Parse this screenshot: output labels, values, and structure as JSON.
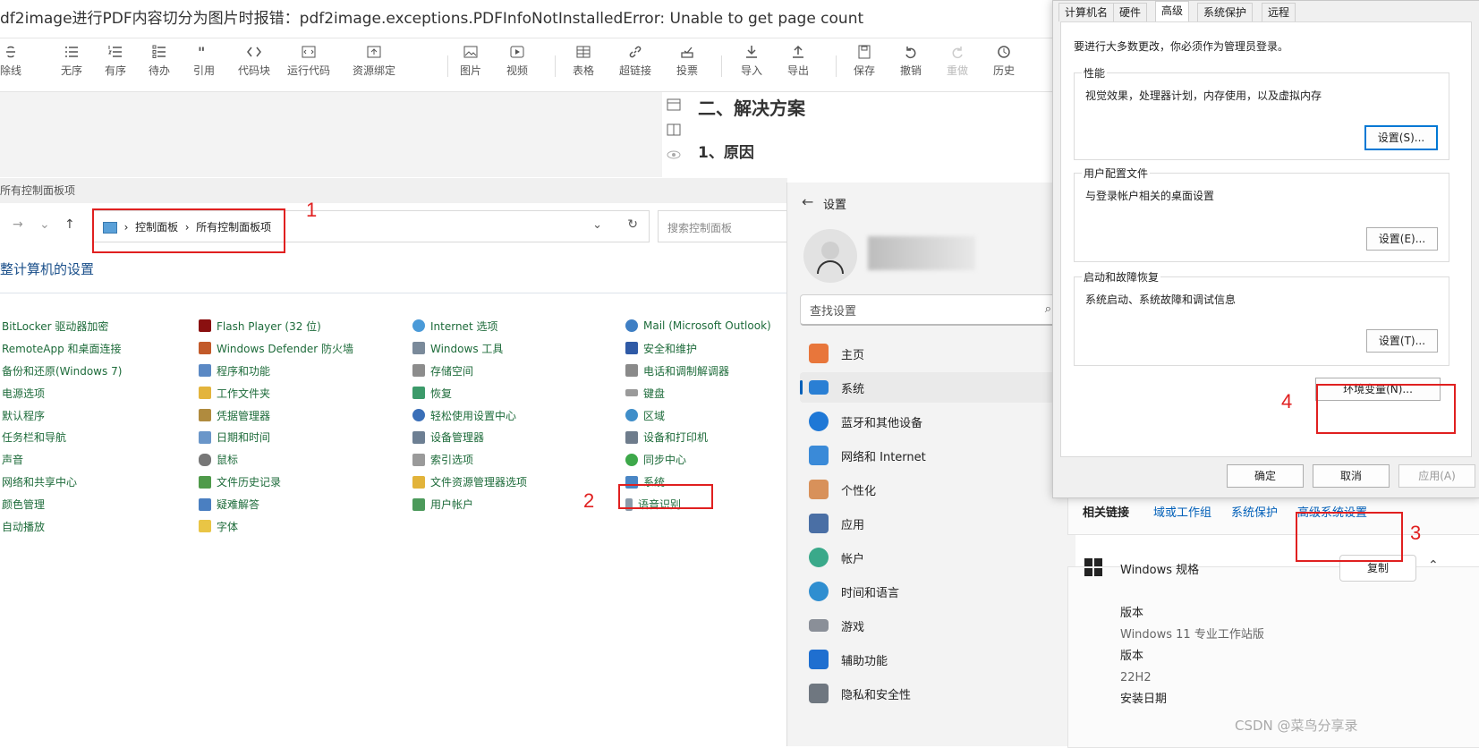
{
  "editor": {
    "title": "df2image进行PDF内容切分为图片时报错：pdf2image.exceptions.PDFInfoNotInstalledError: Unable to get page count",
    "toolbar": [
      "除线",
      "无序",
      "有序",
      "待办",
      "引用",
      "代码块",
      "运行代码",
      "资源绑定",
      "图片",
      "视频",
      "表格",
      "超链接",
      "投票",
      "导入",
      "导出",
      "保存",
      "撤销",
      "重做",
      "历史"
    ],
    "headings": {
      "solution": "二、解决方案",
      "reason": "1、原因"
    }
  },
  "control_panel": {
    "window_title": "所有控制面板项",
    "breadcrumb": [
      "控制面板",
      "所有控制面板项"
    ],
    "search_placeholder": "搜索控制面板",
    "heading": "整计算机的设置",
    "columns": [
      [
        "BitLocker 驱动器加密",
        "RemoteApp 和桌面连接",
        "备份和还原(Windows 7)",
        "电源选项",
        "默认程序",
        "任务栏和导航",
        "声音",
        "网络和共享中心",
        "颜色管理",
        "自动播放"
      ],
      [
        "Flash Player (32 位)",
        "Windows Defender 防火墙",
        "程序和功能",
        "工作文件夹",
        "凭据管理器",
        "日期和时间",
        "鼠标",
        "文件历史记录",
        "疑难解答",
        "字体"
      ],
      [
        "Internet 选项",
        "Windows 工具",
        "存储空间",
        "恢复",
        "轻松使用设置中心",
        "设备管理器",
        "索引选项",
        "文件资源管理器选项",
        "用户帐户"
      ],
      [
        "Mail (Microsoft Outlook)",
        "安全和维护",
        "电话和调制解调器",
        "键盘",
        "区域",
        "设备和打印机",
        "同步中心",
        "系统",
        "语音识别"
      ]
    ]
  },
  "settings": {
    "title": "设置",
    "search_placeholder": "查找设置",
    "nav": [
      "主页",
      "系统",
      "蓝牙和其他设备",
      "网络和 Internet",
      "个性化",
      "应用",
      "帐户",
      "时间和语言",
      "游戏",
      "辅助功能",
      "隐私和安全性"
    ],
    "active_nav": "系统",
    "related": {
      "label": "相关链接",
      "links": [
        "域或工作组",
        "系统保护",
        "高级系统设置"
      ]
    },
    "windows_spec": {
      "title": "Windows 规格",
      "copy": "复制",
      "rows": [
        {
          "label": "版本",
          "value": "Windows 11 专业工作站版"
        },
        {
          "label": "版本",
          "value": "22H2"
        },
        {
          "label": "安装日期",
          "value": ""
        }
      ]
    }
  },
  "system_properties": {
    "tabs": [
      "计算机名",
      "硬件",
      "高级",
      "系统保护",
      "远程"
    ],
    "active_tab": "高级",
    "note": "要进行大多数更改，你必须作为管理员登录。",
    "groups": [
      {
        "title": "性能",
        "desc": "视觉效果，处理器计划，内存使用，以及虚拟内存",
        "button": "设置(S)..."
      },
      {
        "title": "用户配置文件",
        "desc": "与登录帐户相关的桌面设置",
        "button": "设置(E)..."
      },
      {
        "title": "启动和故障恢复",
        "desc": "系统启动、系统故障和调试信息",
        "button": "设置(T)..."
      }
    ],
    "env_button": "环境变量(N)...",
    "ok": "确定",
    "cancel": "取消",
    "apply": "应用(A)"
  },
  "annotations": [
    "1",
    "2",
    "3",
    "4"
  ],
  "watermark": "CSDN @菜鸟分享录"
}
